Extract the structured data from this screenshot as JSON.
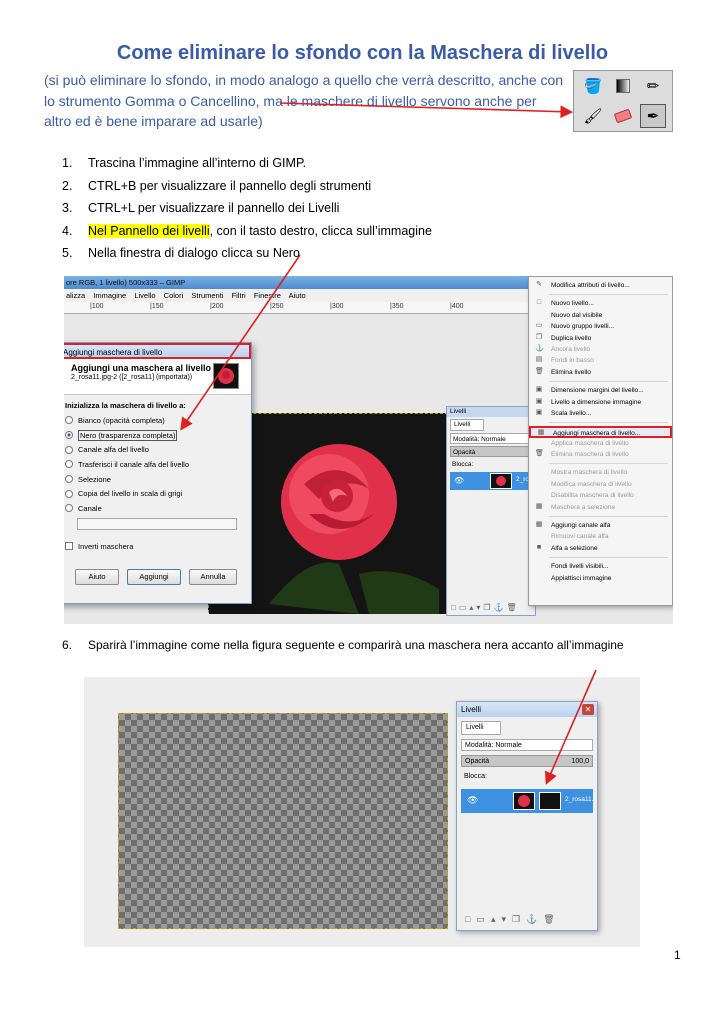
{
  "title": "Come eliminare lo sfondo con la Maschera di livello",
  "intro": "(si può eliminare lo sfondo, in modo analogo a quello che verrà descritto, anche con lo strumento Gomma o Cancellino, ma le maschere di livello servono anche per altro ed è bene imparare ad usarle)",
  "steps": [
    {
      "num": "1.",
      "text": "Trascina l’immagine all’interno di GIMP."
    },
    {
      "num": "2.",
      "text": "CTRL+B per visualizzare il pannello degli strumenti"
    },
    {
      "num": "3.",
      "text": "CTRL+L per visualizzare il pannello dei Livelli"
    },
    {
      "num": "4.",
      "highlight": "Nel Pannello dei livelli",
      "text": ", con il tasto destro, clicca sull’immagine"
    },
    {
      "num": "5.",
      "text": "Nella finestra di dialogo clicca su Nero"
    }
  ],
  "gimp": {
    "window_title": "ore RGB, 1 livello) 500x333 – GIMP",
    "menus": [
      "alizza",
      "Immagine",
      "Livello",
      "Colori",
      "Strumenti",
      "Filtri",
      "Finestre",
      "Aiuto"
    ],
    "ruler": [
      "|100",
      "|150",
      "|200",
      "|250",
      "|300",
      "|350",
      "|400"
    ]
  },
  "dialog": {
    "title": "Aggiungi maschera di livello",
    "heading": "Aggiungi una maschera al livello",
    "subheading": "2_rosa11.jpg-2 ([2_rosa11] (importata))",
    "init_label": "Inizializza la maschera di livello a:",
    "options": [
      "Bianco (opacità completa)",
      "Nero (trasparenza completa)",
      "Canale alfa del livello",
      "Trasferisci il canale alfa del livello",
      "Selezione",
      "Copia del livello in scala di grigi",
      "Canale"
    ],
    "selected": 1,
    "invert_label": "Inverti maschera",
    "buttons": [
      "Aiuto",
      "Aggiungi",
      "Annulla"
    ]
  },
  "layers1": {
    "title": "Livelli",
    "tab": "Livelli",
    "mode": "Modalità: Normale",
    "opacity": "Opacità",
    "lock": "Blocca:",
    "layer_name": "2_ros"
  },
  "context_menu": [
    {
      "label": "Modifica attributi di livello...",
      "icon": "✎"
    },
    {
      "sep": true
    },
    {
      "label": "Nuovo livello...",
      "icon": "□"
    },
    {
      "label": "Nuovo dal visibile"
    },
    {
      "label": "Nuovo gruppo livelli...",
      "icon": "▭"
    },
    {
      "label": "Duplica livello",
      "icon": "❐"
    },
    {
      "label": "Ancora livello",
      "icon": "⚓",
      "disabled": true
    },
    {
      "label": "Fondi in basso",
      "icon": "▤",
      "disabled": true
    },
    {
      "label": "Elimina livello",
      "icon": "🗑"
    },
    {
      "sep": true
    },
    {
      "label": "Dimensione margini del livello...",
      "icon": "▣"
    },
    {
      "label": "Livello a dimensione immagine",
      "icon": "▣"
    },
    {
      "label": "Scala livello...",
      "icon": "▣"
    },
    {
      "sep": true
    },
    {
      "label": "Aggiungi maschera di livello...",
      "icon": "▦",
      "target": true
    },
    {
      "label": "Applica maschera di livello",
      "disabled": true
    },
    {
      "label": "Elimina maschera di livello",
      "icon": "🗑",
      "disabled": true
    },
    {
      "sep": true
    },
    {
      "label": "Mostra maschera di livello",
      "disabled": true
    },
    {
      "label": "Modifica maschera di livello",
      "disabled": true
    },
    {
      "label": "Disabilita maschera di livello",
      "disabled": true
    },
    {
      "label": "Maschera a selezione",
      "icon": "▦",
      "disabled": true
    },
    {
      "sep": true
    },
    {
      "label": "Aggiungi canale alfa",
      "icon": "▦"
    },
    {
      "label": "Rimuovi canale alfa",
      "disabled": true
    },
    {
      "label": "Alfa a selezione",
      "icon": "■"
    },
    {
      "sep": true
    },
    {
      "label": "Fondi livelli visibili..."
    },
    {
      "label": "Appiattisci immagine"
    }
  ],
  "step6": {
    "num": "6.",
    "text": "Sparirà l’immagine come nella figura seguente e comparirà una maschera nera accanto all’immagine"
  },
  "layers2": {
    "title": "Livelli",
    "tab": "Livelli",
    "mode": "Modalità: Normale",
    "opacity": "Opacità",
    "opacity_value": "100,0",
    "lock": "Blocca:",
    "layer_name": "2_rosa11."
  },
  "page_number": "1",
  "colors": {
    "title": "#3a5ca8",
    "arrow": "#e02020",
    "highlight": "#ffff00",
    "layer_selected": "#3e91e0"
  }
}
